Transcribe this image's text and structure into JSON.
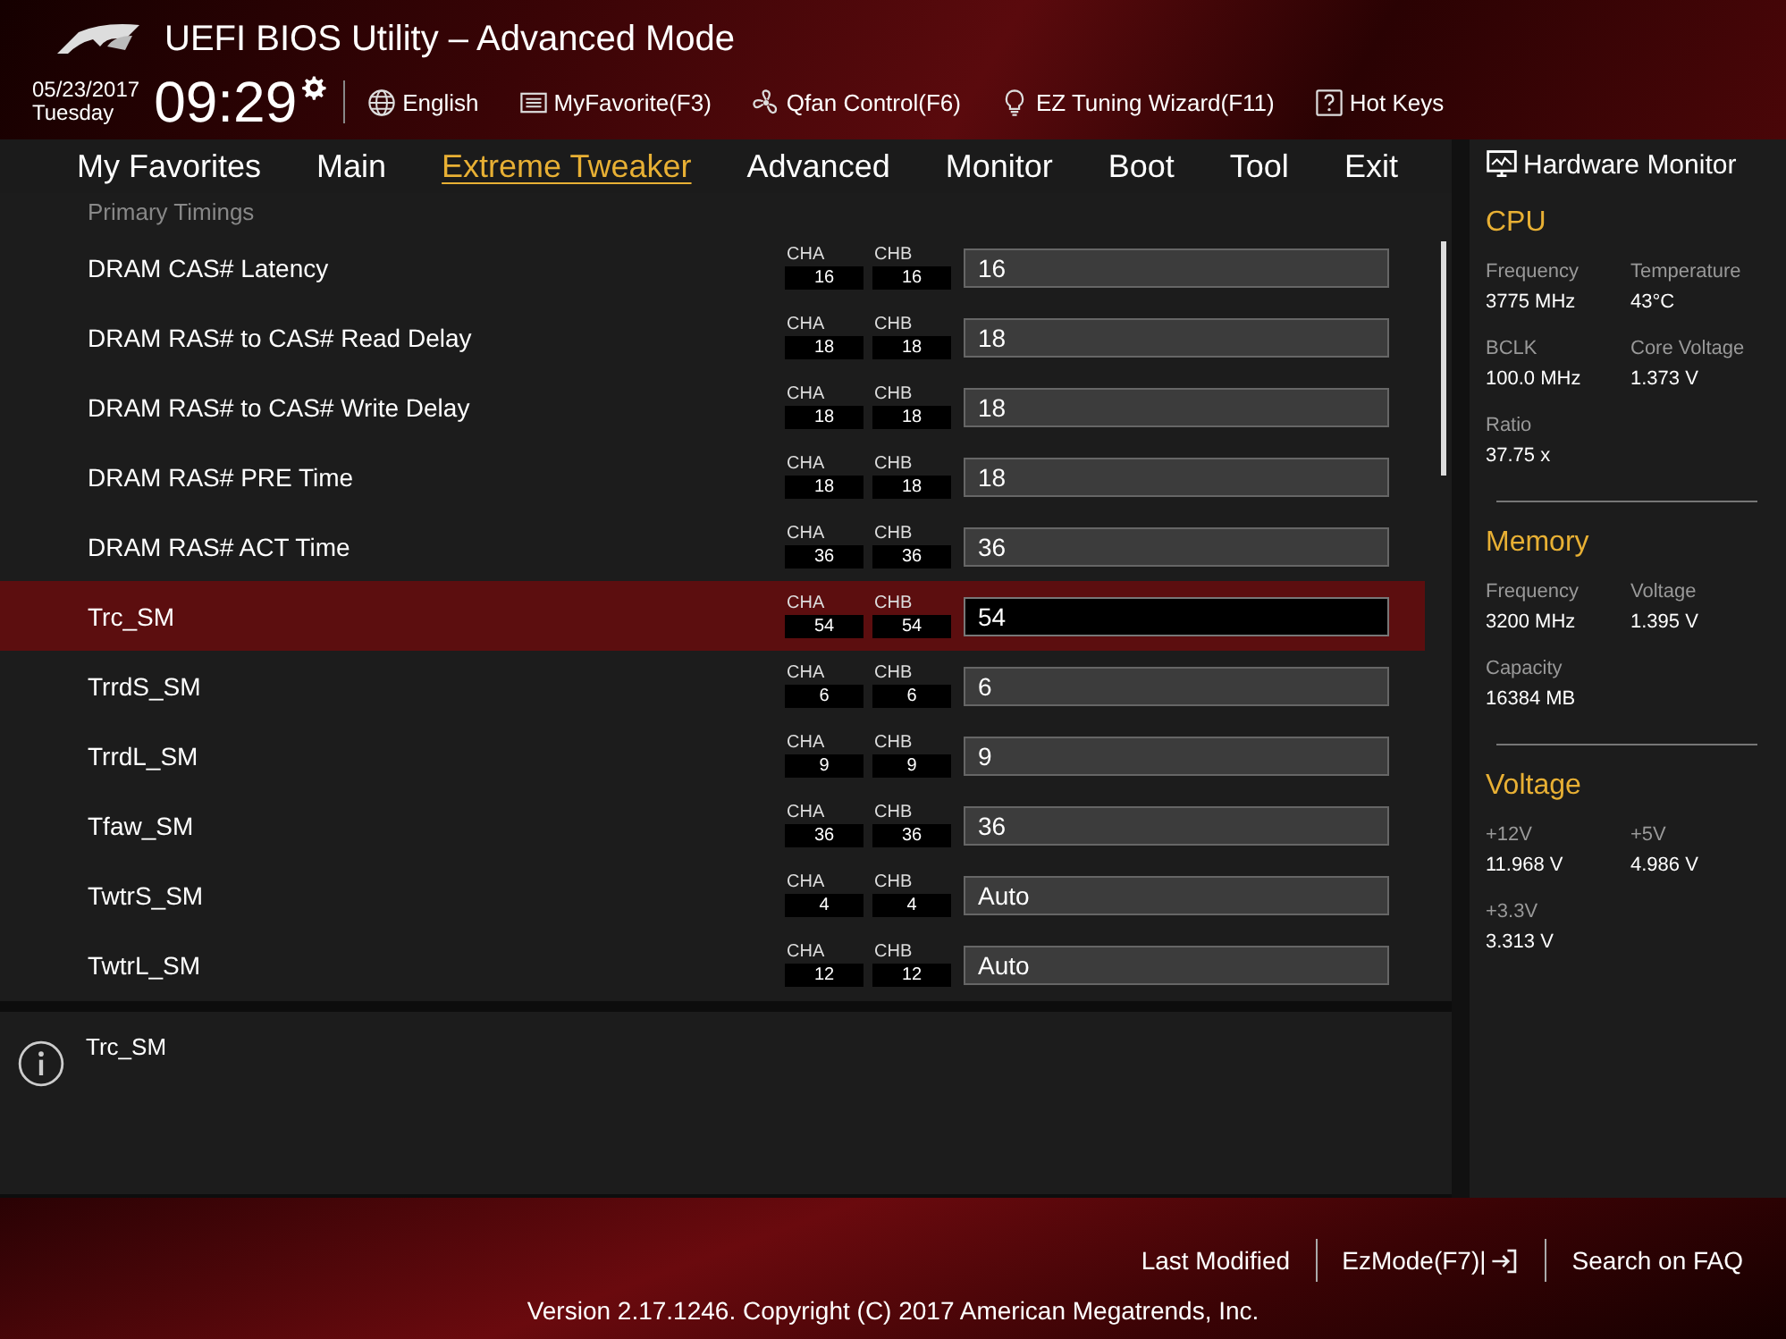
{
  "header": {
    "title": "UEFI BIOS Utility – Advanced Mode",
    "date": "05/23/2017",
    "day": "Tuesday",
    "time": "09:29",
    "tools": [
      {
        "label": "English",
        "kind": "language"
      },
      {
        "label": "MyFavorite(F3)",
        "kind": "favorites"
      },
      {
        "label": "Qfan Control(F6)",
        "kind": "fan"
      },
      {
        "label": "EZ Tuning Wizard(F11)",
        "kind": "wizard"
      },
      {
        "label": "Hot Keys",
        "kind": "help"
      }
    ]
  },
  "tabs": [
    {
      "label": "My Favorites",
      "selected": false
    },
    {
      "label": "Main",
      "selected": false
    },
    {
      "label": "Extreme Tweaker",
      "selected": true
    },
    {
      "label": "Advanced",
      "selected": false
    },
    {
      "label": "Monitor",
      "selected": false
    },
    {
      "label": "Boot",
      "selected": false
    },
    {
      "label": "Tool",
      "selected": false
    },
    {
      "label": "Exit",
      "selected": false
    }
  ],
  "section_title": "Primary Timings",
  "rows": [
    {
      "label": "DRAM CAS# Latency",
      "cha_label": "CHA",
      "cha": "16",
      "chb_label": "CHB",
      "chb": "16",
      "value": "16",
      "selected": false
    },
    {
      "label": "DRAM RAS# to CAS# Read Delay",
      "cha_label": "CHA",
      "cha": "18",
      "chb_label": "CHB",
      "chb": "18",
      "value": "18",
      "selected": false
    },
    {
      "label": "DRAM RAS# to CAS# Write Delay",
      "cha_label": "CHA",
      "cha": "18",
      "chb_label": "CHB",
      "chb": "18",
      "value": "18",
      "selected": false
    },
    {
      "label": "DRAM RAS# PRE Time",
      "cha_label": "CHA",
      "cha": "18",
      "chb_label": "CHB",
      "chb": "18",
      "value": "18",
      "selected": false
    },
    {
      "label": "DRAM RAS# ACT Time",
      "cha_label": "CHA",
      "cha": "36",
      "chb_label": "CHB",
      "chb": "36",
      "value": "36",
      "selected": false
    },
    {
      "label": "Trc_SM",
      "cha_label": "CHA",
      "cha": "54",
      "chb_label": "CHB",
      "chb": "54",
      "value": "54",
      "selected": true
    },
    {
      "label": "TrrdS_SM",
      "cha_label": "CHA",
      "cha": "6",
      "chb_label": "CHB",
      "chb": "6",
      "value": "6",
      "selected": false
    },
    {
      "label": "TrrdL_SM",
      "cha_label": "CHA",
      "cha": "9",
      "chb_label": "CHB",
      "chb": "9",
      "value": "9",
      "selected": false
    },
    {
      "label": "Tfaw_SM",
      "cha_label": "CHA",
      "cha": "36",
      "chb_label": "CHB",
      "chb": "36",
      "value": "36",
      "selected": false
    },
    {
      "label": "TwtrS_SM",
      "cha_label": "CHA",
      "cha": "4",
      "chb_label": "CHB",
      "chb": "4",
      "value": "Auto",
      "selected": false
    },
    {
      "label": "TwtrL_SM",
      "cha_label": "CHA",
      "cha": "12",
      "chb_label": "CHB",
      "chb": "12",
      "value": "Auto",
      "selected": false
    }
  ],
  "help": {
    "text": "Trc_SM"
  },
  "hardware_monitor": {
    "title": "Hardware Monitor",
    "sections": [
      {
        "title": "CPU",
        "items": [
          {
            "label": "Frequency",
            "value": "3775 MHz"
          },
          {
            "label": "Temperature",
            "value": "43°C"
          },
          {
            "label": "BCLK",
            "value": "100.0 MHz"
          },
          {
            "label": "Core Voltage",
            "value": "1.373 V"
          },
          {
            "label": "Ratio",
            "value": "37.75 x"
          }
        ]
      },
      {
        "title": "Memory",
        "items": [
          {
            "label": "Frequency",
            "value": "3200 MHz"
          },
          {
            "label": "Voltage",
            "value": "1.395 V"
          },
          {
            "label": "Capacity",
            "value": "16384 MB"
          }
        ]
      },
      {
        "title": "Voltage",
        "items": [
          {
            "label": "+12V",
            "value": "11.968 V"
          },
          {
            "label": "+5V",
            "value": "4.986 V"
          },
          {
            "label": "+3.3V",
            "value": "3.313 V"
          }
        ]
      }
    ]
  },
  "footer": {
    "links": [
      {
        "label": "Last Modified",
        "kind": "text"
      },
      {
        "label": "EzMode(F7)|",
        "kind": "mode_switch"
      },
      {
        "label": "Search on FAQ",
        "kind": "text"
      }
    ],
    "copyright": "Version 2.17.1246. Copyright (C) 2017 American Megatrends, Inc."
  }
}
